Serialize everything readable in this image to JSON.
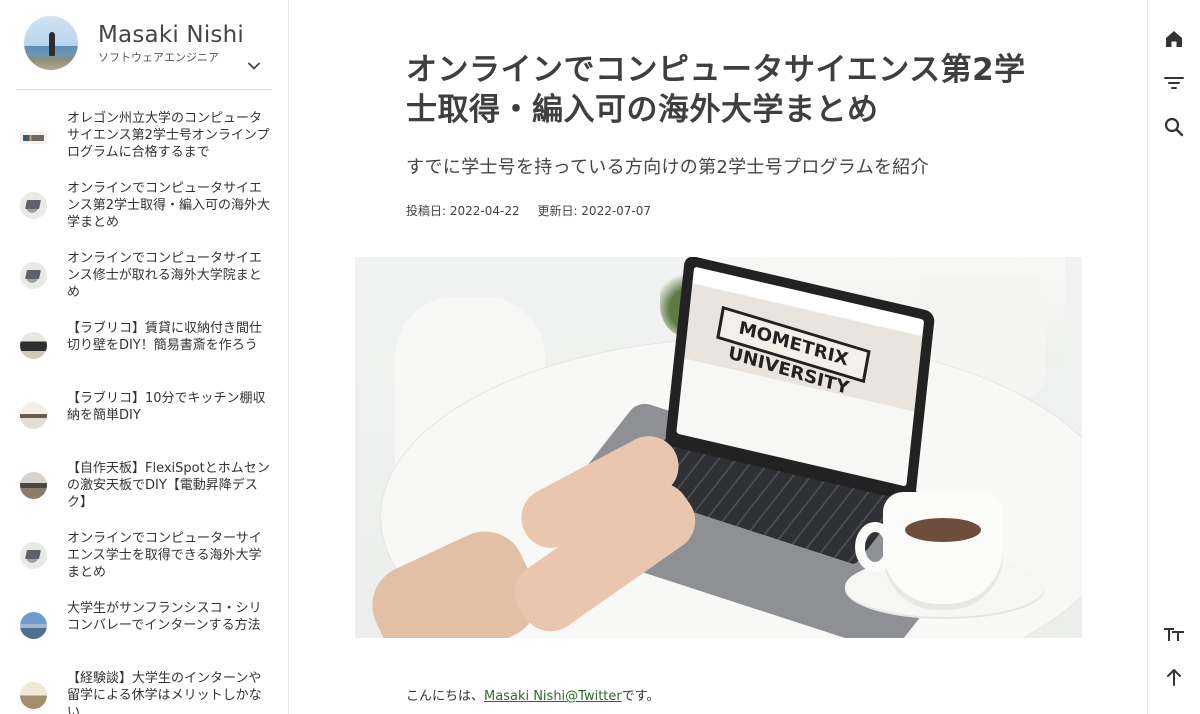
{
  "profile": {
    "name": "Masaki Nishi",
    "role": "ソフトウェアエンジニア"
  },
  "sidebar": {
    "posts": [
      {
        "title": "オレゴン州立大学のコンピュータサイエンス第2学士号オンラインプログラムに合格するまで",
        "thumb": "banner"
      },
      {
        "title": "オンラインでコンピュータサイエンス第2学士取得・編入可の海外大学まとめ",
        "thumb": "laptop"
      },
      {
        "title": "オンラインでコンピュータサイエンス修士が取れる海外大学院まとめ",
        "thumb": "laptop"
      },
      {
        "title": "【ラブリコ】賃貸に収納付き間仕切り壁をDIY！簡易書斎を作ろう",
        "thumb": "room"
      },
      {
        "title": "【ラブリコ】10分でキッチン棚収納を簡単DIY",
        "thumb": "shelf"
      },
      {
        "title": "【自作天板】FlexiSpotとホムセンの激安天板でDIY【電動昇降デスク】",
        "thumb": "desk"
      },
      {
        "title": "オンラインでコンピューターサイエンス学士を取得できる海外大学まとめ",
        "thumb": "laptop"
      },
      {
        "title": "大学生がサンフランシスコ・シリコンバレーでインターンする方法",
        "thumb": "city"
      },
      {
        "title": "【経験談】大学生のインターンや留学による休学はメリットしかない",
        "thumb": "classroom"
      }
    ]
  },
  "article": {
    "title": "オンラインでコンピュータサイエンス第2学士取得・編入可の海外大学まとめ",
    "subtitle": "すでに学士号を持っている方向けの第2学士号プログラムを紹介",
    "posted_label": "投稿日: 2022-04-22",
    "updated_label": "更新日: 2022-07-07",
    "hero_logo_text": "MOMETRIX UNIVERSITY",
    "intro_prefix": "こんにちは、",
    "intro_link": "Masaki Nishi@Twitter",
    "intro_suffix": "です。"
  },
  "rail": {
    "icons": [
      "home-icon",
      "filter-icon",
      "search-icon",
      "text-size-icon",
      "arrow-up-icon"
    ]
  }
}
